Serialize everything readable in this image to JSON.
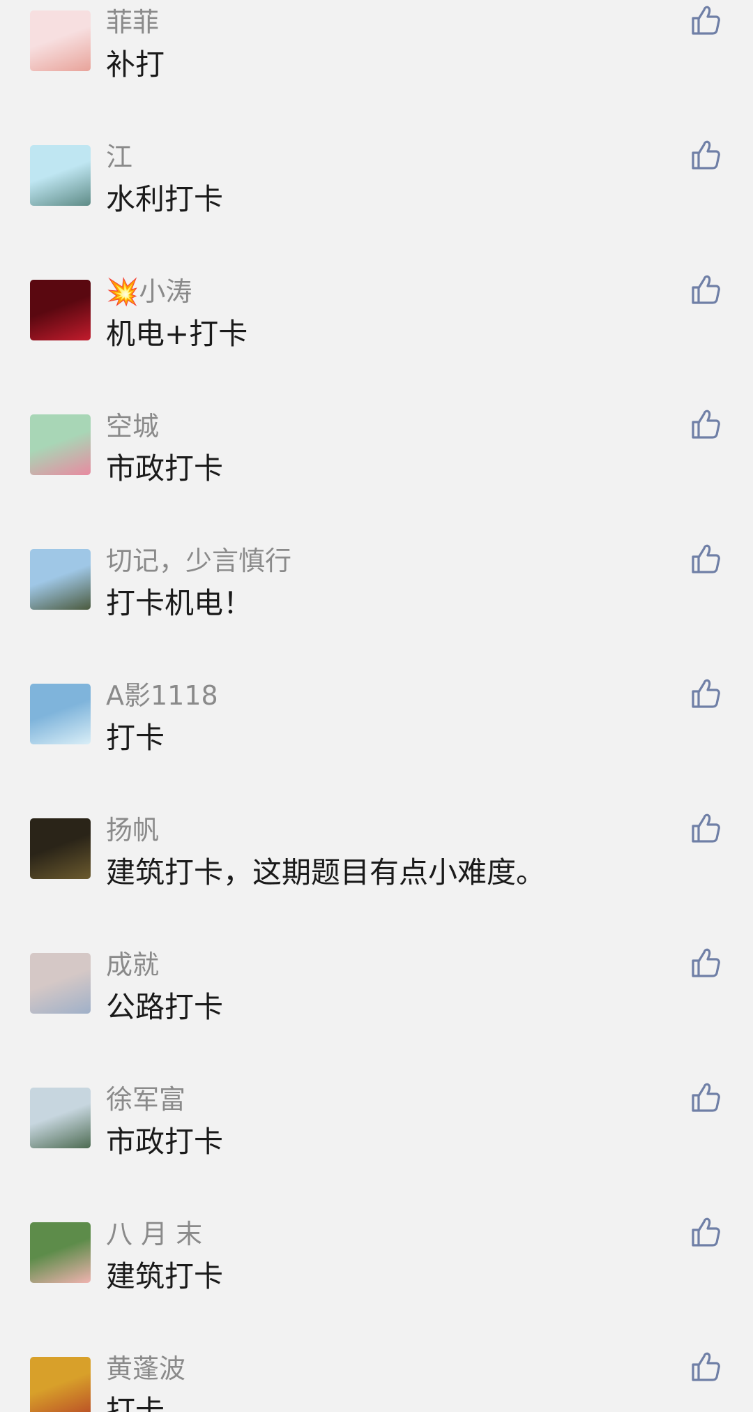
{
  "comments": [
    {
      "name": "菲​菲",
      "text": "补打",
      "avatar_colors": [
        "#f7dfe0",
        "#e8a39a"
      ]
    },
    {
      "name": "江",
      "text": "水利打卡",
      "avatar_colors": [
        "#bfe6f2",
        "#5e8b86"
      ]
    },
    {
      "name": "💥小涛",
      "text": "机电+打卡",
      "avatar_colors": [
        "#5a0810",
        "#c21c2d"
      ]
    },
    {
      "name": "空城",
      "text": "市政打卡",
      "avatar_colors": [
        "#a8d6b6",
        "#e88aa0"
      ]
    },
    {
      "name": "切记，少言慎行",
      "text": "打卡机电！",
      "avatar_colors": [
        "#9fc7e6",
        "#4b5a3e"
      ]
    },
    {
      "name": "A影1118",
      "text": "打卡",
      "avatar_colors": [
        "#7fb4db",
        "#d9eef7"
      ]
    },
    {
      "name": "扬帆",
      "text": "建筑打卡，这期题目有点小难度。",
      "avatar_colors": [
        "#2a2418",
        "#6b5a2e"
      ]
    },
    {
      "name": "成就",
      "text": "公路打卡",
      "avatar_colors": [
        "#d5c8c6",
        "#9fb0c8"
      ]
    },
    {
      "name": "徐军富",
      "text": "市政打卡",
      "avatar_colors": [
        "#c7d6df",
        "#4d6b52"
      ]
    },
    {
      "name": "八 月 末",
      "text": "建筑打卡",
      "avatar_colors": [
        "#5d8c4a",
        "#f0b3b0"
      ]
    },
    {
      "name": "黄蓬波",
      "text": "打卡",
      "avatar_colors": [
        "#d8a02a",
        "#b84a26"
      ]
    }
  ],
  "icons": {
    "like": "thumbs-up-icon"
  },
  "colors": {
    "background": "#f2f2f2",
    "name_text": "#8a8a8a",
    "comment_text": "#1a1a1a",
    "like_icon": "#6f7fa6"
  }
}
